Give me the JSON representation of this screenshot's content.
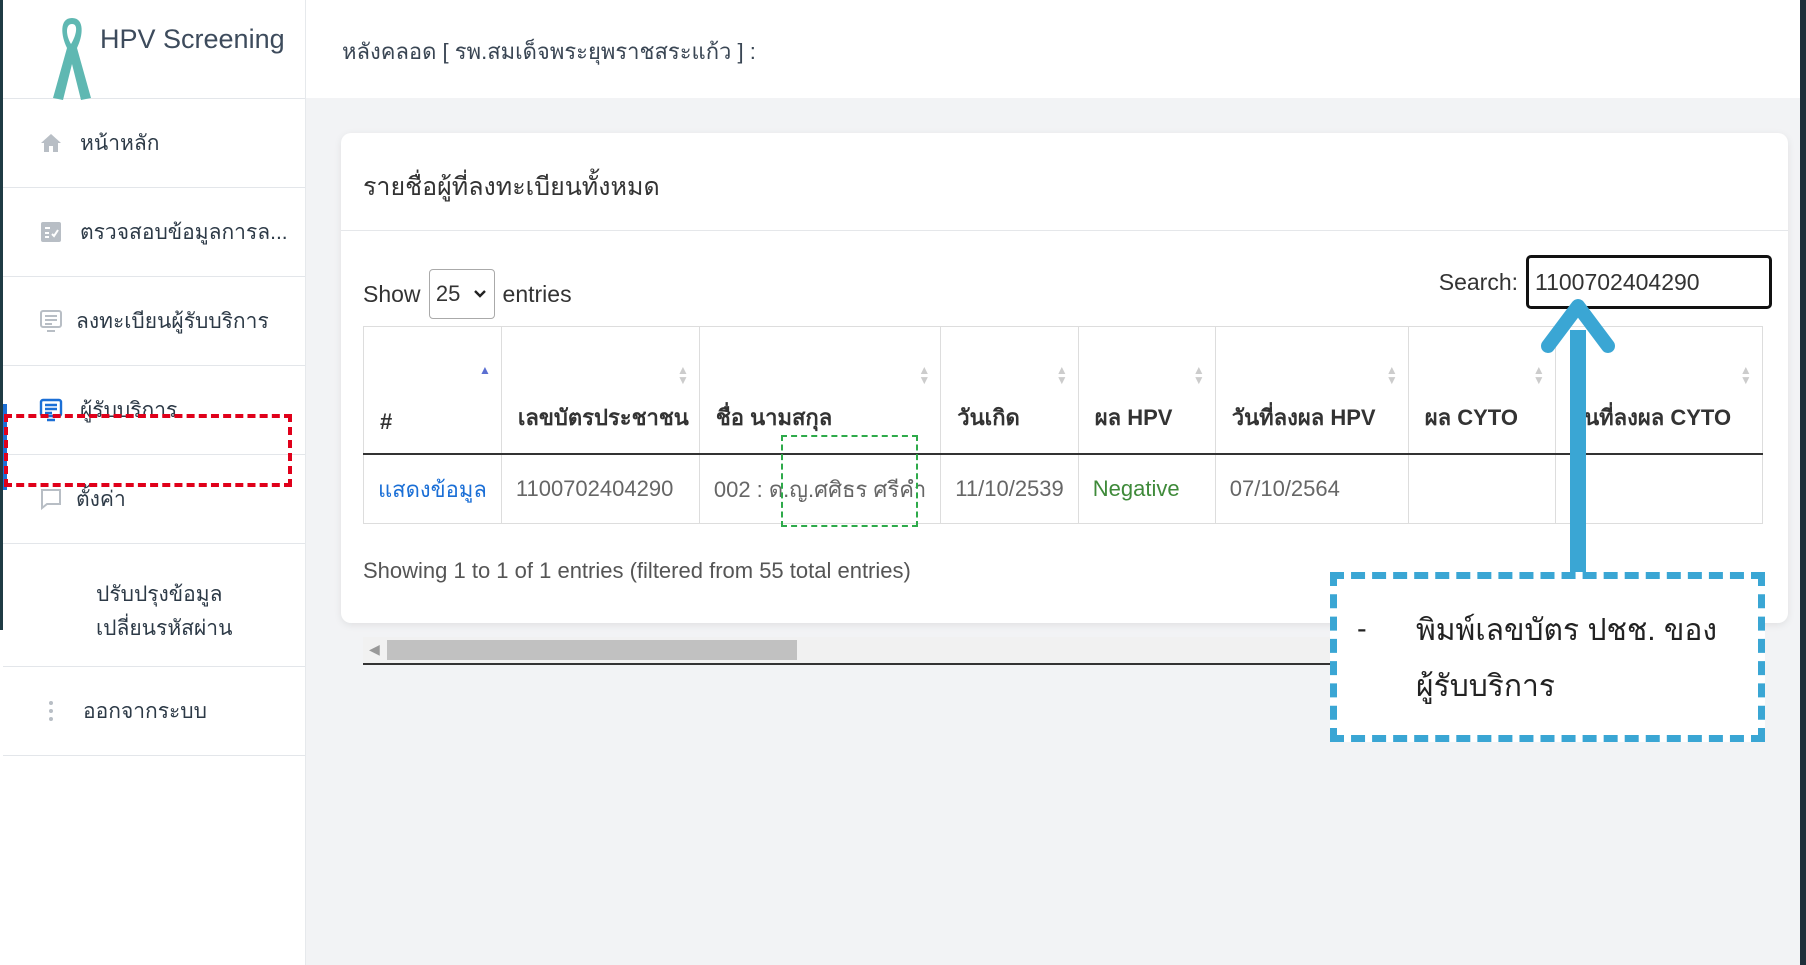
{
  "app": {
    "title": "HPV Screening"
  },
  "sidebar": {
    "items": [
      {
        "label": "หน้าหลัก",
        "icon": "home-icon"
      },
      {
        "label": "ตรวจสอบข้อมูลการล...",
        "icon": "checklist-icon"
      },
      {
        "label": "ลงทะเบียนผู้รับบริการ",
        "icon": "register-icon"
      },
      {
        "label": "ผู้รับบริการ",
        "icon": "list-icon"
      },
      {
        "label": "ตั้งค่า",
        "icon": "chat-icon"
      }
    ],
    "submenu": {
      "line1": "ปรับปรุงข้อมูล",
      "line2": "เปลี่ยนรหัสผ่าน"
    },
    "logout": {
      "label": "ออกจากระบบ",
      "icon": "more-vertical-icon"
    }
  },
  "header": {
    "breadcrumb": "หลังคลอด [ รพ.สมเด็จพระยุพราชสระแก้ว ] :"
  },
  "card": {
    "title": "รายชื่อผู้ที่ลงทะเบียนทั้งหมด",
    "show_label": "Show",
    "entries_label": "entries",
    "page_size": "25",
    "search_label": "Search:",
    "search_value": "1100702404290",
    "columns": [
      "#",
      "เลขบัตรประชาชน",
      "ชื่อ นามสกุล",
      "วันเกิด",
      "ผล HPV",
      "วันที่ลงผล HPV",
      "ผล CYTO",
      "วันที่ลงผล CYTO"
    ],
    "rows": [
      {
        "action": "แสดงข้อมูล",
        "id": "1100702404290",
        "name": "002 : ด.ญ.ศศิธร ศรีคำ",
        "dob": "11/10/2539",
        "hpv": "Negative",
        "hpv_date": "07/10/2564",
        "cyto": "",
        "cyto_date": ""
      }
    ],
    "info": "Showing 1 to 1 of 1 entries (filtered from 55 total entries)"
  },
  "callout": {
    "dash": "-",
    "line1": "พิมพ์เลขบัตร ปชช. ของ",
    "line2": "ผู้รับบริการ"
  },
  "colors": {
    "highlight_red": "#e0001a",
    "highlight_green": "#2eaa4a",
    "callout_blue": "#3aa6d4"
  }
}
